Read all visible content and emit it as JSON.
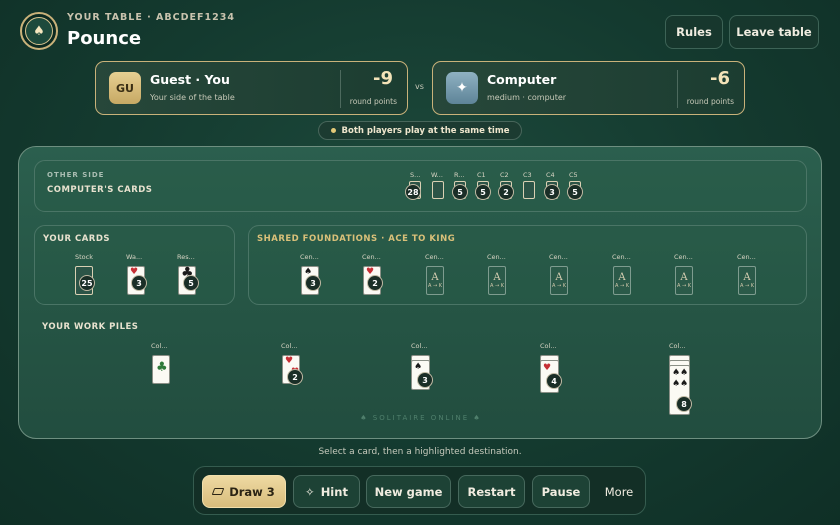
{
  "header": {
    "table_id": "YOUR TABLE · ABCDEF1234",
    "title": "Pounce",
    "logo_text": "SOLITAIRE",
    "rules_label": "Rules",
    "leave_label": "Leave table"
  },
  "players": {
    "you": {
      "avatar": "GU",
      "name": "Guest · You",
      "sub": "Your side of the table",
      "score": "-9",
      "score_label": "round points"
    },
    "vs": "vs",
    "opponent": {
      "avatar_icon": "✦",
      "name": "Computer",
      "sub": "medium · computer",
      "score": "-6",
      "score_label": "round points"
    }
  },
  "banner": "Both players play at the same time",
  "opponent_side": {
    "kicker": "OTHER SIDE",
    "title": "COMPUTER'S CARDS",
    "piles": [
      {
        "name": "S...",
        "count": "28"
      },
      {
        "name": "W..."
      },
      {
        "name": "R...",
        "count": "5"
      },
      {
        "name": "C1",
        "count": "5"
      },
      {
        "name": "C2",
        "count": "2"
      },
      {
        "name": "C3"
      },
      {
        "name": "C4",
        "count": "3"
      },
      {
        "name": "C5",
        "count": "5"
      }
    ]
  },
  "your_cards": {
    "title": "YOUR CARDS",
    "piles": [
      {
        "name": "Stock",
        "count": "25"
      },
      {
        "name": "Wa...",
        "count": "3"
      },
      {
        "name": "Res...",
        "count": "5"
      }
    ]
  },
  "foundations": {
    "title": "SHARED FOUNDATIONS · ACE TO KING",
    "empty_letter": "A",
    "empty_sub": "A → K",
    "piles": [
      {
        "name": "Cen...",
        "count": "3"
      },
      {
        "name": "Cen...",
        "count": "2"
      },
      {
        "name": "Cen..."
      },
      {
        "name": "Cen..."
      },
      {
        "name": "Cen..."
      },
      {
        "name": "Cen..."
      },
      {
        "name": "Cen..."
      },
      {
        "name": "Cen..."
      }
    ]
  },
  "work_piles": {
    "title": "YOUR WORK PILES",
    "piles": [
      {
        "name": "Col..."
      },
      {
        "name": "Col...",
        "count": "2"
      },
      {
        "name": "Col...",
        "count": "3"
      },
      {
        "name": "Col...",
        "count": "4"
      },
      {
        "name": "Col...",
        "count": "8"
      }
    ]
  },
  "watermark": "♠ SOLITAIRE ONLINE ♠",
  "status_text": "Select a card, then a highlighted destination.",
  "toolbar": {
    "draw": "Draw 3",
    "hint_icon": "✧",
    "hint": "Hint",
    "new_game": "New game",
    "restart": "Restart",
    "pause": "Pause",
    "more": "More"
  },
  "colors": {
    "accent_gold": "#d9c079",
    "felt": "#255444",
    "card_red": "#c62f35"
  }
}
